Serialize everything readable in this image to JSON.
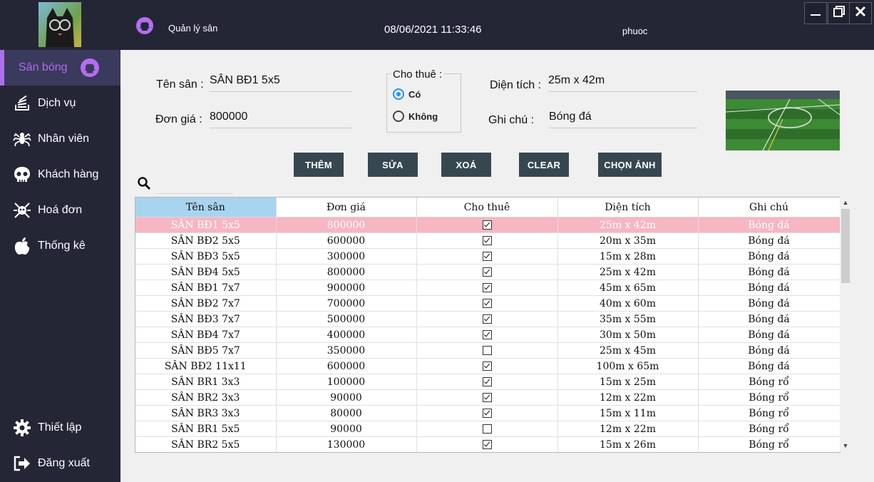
{
  "topbar": {
    "app_title": "Quản lý sân",
    "datetime": "08/06/2021 11:33:46",
    "username": "phuoc"
  },
  "sidebar": {
    "items": [
      {
        "label": "Sân bóng",
        "icon": "github-icon"
      },
      {
        "label": "Dịch vụ",
        "icon": "stack-icon"
      },
      {
        "label": "Nhân viên",
        "icon": "spider-icon"
      },
      {
        "label": "Khách hàng",
        "icon": "skull-icon"
      },
      {
        "label": "Hoá đơn",
        "icon": "bug-icon"
      },
      {
        "label": "Thống kê",
        "icon": "apple-icon"
      }
    ],
    "bottom": [
      {
        "label": "Thiết lập",
        "icon": "gear-icon"
      },
      {
        "label": "Đăng xuất",
        "icon": "sign-out-icon"
      }
    ]
  },
  "form": {
    "ten_san_label": "Tên sân :",
    "ten_san_value": "SÂN BĐ1 5x5",
    "don_gia_label": "Đơn giá :",
    "don_gia_value": "800000",
    "cho_thue_label": "Cho thuê :",
    "radio_yes": "Có",
    "radio_no": "Không",
    "dien_tich_label": "Diện tích :",
    "dien_tich_value": "25m x 42m",
    "ghi_chu_label": "Ghi chú :",
    "ghi_chu_value": "Bóng đá"
  },
  "buttons": {
    "them": "THÊM",
    "sua": "SỬA",
    "xoa": "XOÁ",
    "clear": "CLEAR",
    "chon_anh": "CHỌN ẢNH"
  },
  "table": {
    "headers": [
      "Tên sân",
      "Đơn giá",
      "Cho thuê",
      "Diện tích",
      "Ghi chú"
    ],
    "rows": [
      {
        "ten": "SÂN BĐ1 5x5",
        "gia": "800000",
        "thue": true,
        "dt": "25m x 42m",
        "gc": "Bóng đá",
        "selected": true
      },
      {
        "ten": "SÂN BĐ2 5x5",
        "gia": "600000",
        "thue": true,
        "dt": "20m x 35m",
        "gc": "Bóng đá"
      },
      {
        "ten": "SÂN BĐ3 5x5",
        "gia": "300000",
        "thue": true,
        "dt": "15m x 28m",
        "gc": "Bóng đá"
      },
      {
        "ten": "SÂN BĐ4 5x5",
        "gia": "800000",
        "thue": true,
        "dt": "25m x 42m",
        "gc": "Bóng đá"
      },
      {
        "ten": "SÂN BĐ1 7x7",
        "gia": "900000",
        "thue": true,
        "dt": "45m x 65m",
        "gc": "Bóng đá"
      },
      {
        "ten": "SÂN BĐ2 7x7",
        "gia": "700000",
        "thue": true,
        "dt": "40m x 60m",
        "gc": "Bóng đá"
      },
      {
        "ten": "SÂN BĐ3 7x7",
        "gia": "500000",
        "thue": true,
        "dt": "35m x 55m",
        "gc": "Bóng đá"
      },
      {
        "ten": "SÂN BĐ4 7x7",
        "gia": "400000",
        "thue": true,
        "dt": "30m x 50m",
        "gc": "Bóng đá"
      },
      {
        "ten": "SÂN BĐ5 7x7",
        "gia": "350000",
        "thue": false,
        "dt": "25m x 45m",
        "gc": "Bóng đá"
      },
      {
        "ten": "SÂN BĐ2 11x11",
        "gia": "600000",
        "thue": true,
        "dt": "100m x 65m",
        "gc": "Bóng đá"
      },
      {
        "ten": "SÂN BR1 3x3",
        "gia": "100000",
        "thue": true,
        "dt": "15m x 25m",
        "gc": "Bóng rổ"
      },
      {
        "ten": "SÂN BR2 3x3",
        "gia": "90000",
        "thue": true,
        "dt": "12m x 22m",
        "gc": "Bóng rổ"
      },
      {
        "ten": "SÂN BR3 3x3",
        "gia": "80000",
        "thue": true,
        "dt": "15m x 11m",
        "gc": "Bóng rổ"
      },
      {
        "ten": "SÂN BR1 5x5",
        "gia": "90000",
        "thue": false,
        "dt": "12m x 22m",
        "gc": "Bóng rổ"
      },
      {
        "ten": "SÂN BR2 5x5",
        "gia": "130000",
        "thue": true,
        "dt": "15m x 26m",
        "gc": "Bóng rổ"
      }
    ]
  },
  "colors": {
    "sidebar_bg": "#242636",
    "active_accent": "#a971e8",
    "button_bg": "#37474f",
    "selected_row": "#f7b6c2",
    "selected_header": "#a8d4f0"
  }
}
